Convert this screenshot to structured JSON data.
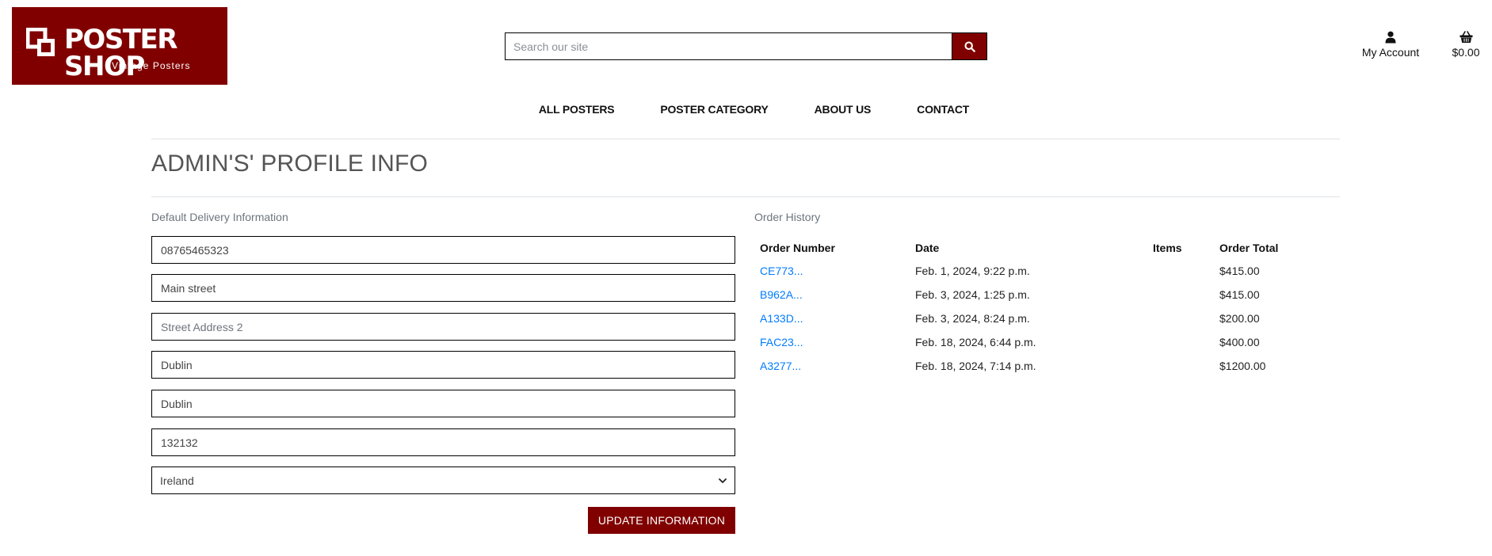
{
  "header": {
    "logo_title": "POSTER SHOP",
    "logo_subtitle": "Vintage Posters",
    "search_placeholder": "Search our site",
    "account_label": "My Account",
    "cart_total": "$0.00",
    "brand_color": "#800000",
    "icons": {
      "logo": "overlapping-squares-icon",
      "search": "search-icon",
      "account": "user-icon",
      "cart": "basket-icon"
    }
  },
  "nav": {
    "items": [
      "ALL POSTERS",
      "POSTER CATEGORY",
      "ABOUT US",
      "CONTACT"
    ]
  },
  "page": {
    "title": "ADMIN'S' PROFILE INFO"
  },
  "delivery": {
    "heading": "Default Delivery Information",
    "phone": "08765465323",
    "street1": "Main street",
    "street2_placeholder": "Street Address 2",
    "town": "Dublin",
    "county": "Dublin",
    "postcode": "132132",
    "country": "Ireland",
    "update_button": "UPDATE INFORMATION"
  },
  "orders": {
    "heading": "Order History",
    "columns": [
      "Order Number",
      "Date",
      "Items",
      "Order Total"
    ],
    "rows": [
      {
        "number": "CE773...",
        "date": "Feb. 1, 2024, 9:22 p.m.",
        "items": "",
        "total": "$415.00"
      },
      {
        "number": "B962A...",
        "date": "Feb. 3, 2024, 1:25 p.m.",
        "items": "",
        "total": "$415.00"
      },
      {
        "number": "A133D...",
        "date": "Feb. 3, 2024, 8:24 p.m.",
        "items": "",
        "total": "$200.00"
      },
      {
        "number": "FAC23...",
        "date": "Feb. 18, 2024, 6:44 p.m.",
        "items": "",
        "total": "$400.00"
      },
      {
        "number": "A3277...",
        "date": "Feb. 18, 2024, 7:14 p.m.",
        "items": "",
        "total": "$1200.00"
      }
    ]
  }
}
